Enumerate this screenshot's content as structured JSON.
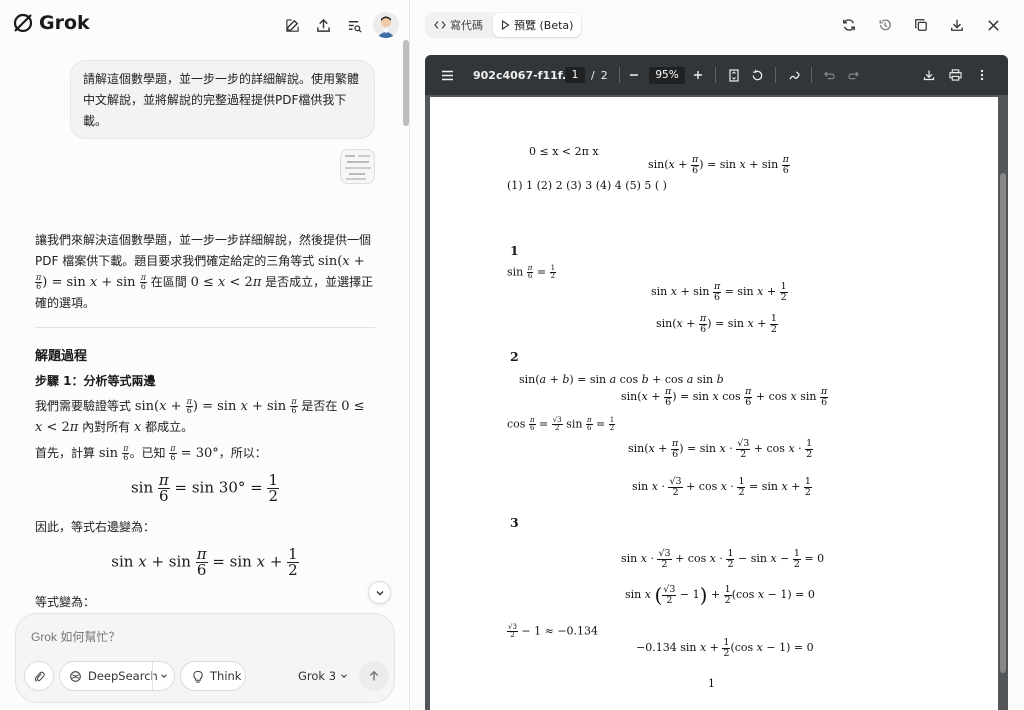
{
  "app": {
    "title": "Grok"
  },
  "chat": {
    "user_message": "請解這個數學題，並一步一步的詳細解說。使用繁體中文解說，並將解說的完整過程提供PDF檔供我下載。",
    "reply_intro_1": "讓我們來解決這個數學題，並一步一步詳細解說，然後提供一個PDF 檔案供下載。題目要求我們確定給定的三角等式 ",
    "reply_intro_2": " 在區間 ",
    "reply_intro_3": " 是否成立，並選擇正確的選項。",
    "heading_process": "解題過程",
    "heading_step1": "步驟 1：分析等式兩邊",
    "p1_a": "我們需要驗證等式 ",
    "p1_b": " 是否在 ",
    "p1_c": " 內對所有 ",
    "p1_d": " 都成立。",
    "p2_a": "首先，計算 ",
    "p2_b": "。已知 ",
    "p2_c": "，所以：",
    "p3": "因此，等式右邊變為：",
    "p4": "等式變為："
  },
  "composer": {
    "placeholder": "Grok 如何幫忙？",
    "deepsearch_label": "DeepSearch",
    "think_label": "Think",
    "model_label": "Grok 3"
  },
  "preview": {
    "tab_code": "寫代碼",
    "tab_preview": "預覽 (Beta)"
  },
  "pdf": {
    "filename": "902c4067-f11f...",
    "page_current": "1",
    "page_sep": "/",
    "page_total": "2",
    "zoom": "95%",
    "sec1": "1",
    "sec2": "2",
    "sec3": "3",
    "options": "(1) 1      (2) 2      (3) 3      (4) 4      (5) 5    ( )",
    "range": "0 ≤ x < 2π       x",
    "approx": "− 1 ≈ −0.134",
    "page_number": "1"
  },
  "colors": {
    "accent": "#1a1a1a",
    "pdf_toolbar": "#323639",
    "pdf_bg": "#525659"
  },
  "icons": [
    "grok-logo-icon",
    "new-chat-icon",
    "share-icon",
    "history-search-icon",
    "avatar",
    "code-icon",
    "play-icon",
    "refresh-icon",
    "history-icon",
    "copy-icon",
    "download-icon",
    "close-icon",
    "menu-icon",
    "minus-icon",
    "plus-icon",
    "fit-page-icon",
    "rotate-icon",
    "annotate-icon",
    "undo-icon",
    "redo-icon",
    "print-icon",
    "more-icon",
    "attach-icon",
    "deepsearch-icon",
    "bulb-icon",
    "chevron-down-icon",
    "send-arrow-icon"
  ]
}
